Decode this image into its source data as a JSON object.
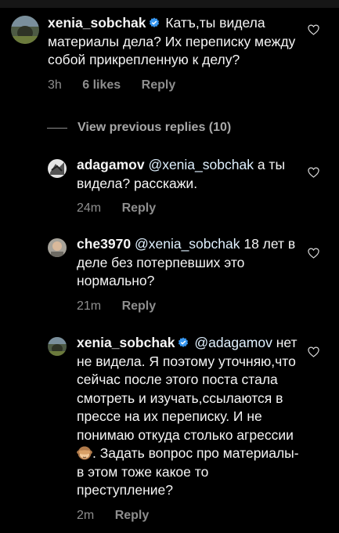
{
  "comments": [
    {
      "username": "xenia_sobchak",
      "verified": true,
      "text": "Катъ,ты видела материалы дела? Их переписку между собой прикрепленную к делу?",
      "time": "3h",
      "likes": "6 likes",
      "reply": "Reply"
    }
  ],
  "view_previous": "View previous replies (10)",
  "replies": [
    {
      "username": "adagamov",
      "verified": false,
      "mention": "@xenia_sobchak",
      "text": "а ты видела? расскажи.",
      "time": "24m",
      "reply": "Reply"
    },
    {
      "username": "che3970",
      "verified": false,
      "mention": "@xenia_sobchak",
      "text": "18 лет в деле без потерпевших это нормально?",
      "time": "21m",
      "reply": "Reply"
    },
    {
      "username": "xenia_sobchak",
      "verified": true,
      "mention": "@adagamov",
      "text": "нет не видела. Я поэтому уточняю,что сейчас после этого поста стала смотреть и изучать,ссылаются в прессе на их переписку. И не понимаю откуда столько агрессии",
      "emoji": "see-no-evil-monkey",
      "text_after": ". Задать вопрос про материалы-в этом тоже какое то преступление?",
      "time": "2m",
      "reply": "Reply"
    }
  ],
  "icons": {
    "like": "heart-outline-icon",
    "verified": "verified-badge-icon"
  },
  "colors": {
    "background": "#000000",
    "text": "#f5f5f5",
    "secondary": "#8e8e8e",
    "verified": "#3897f0",
    "mention": "#e0f1ff"
  }
}
